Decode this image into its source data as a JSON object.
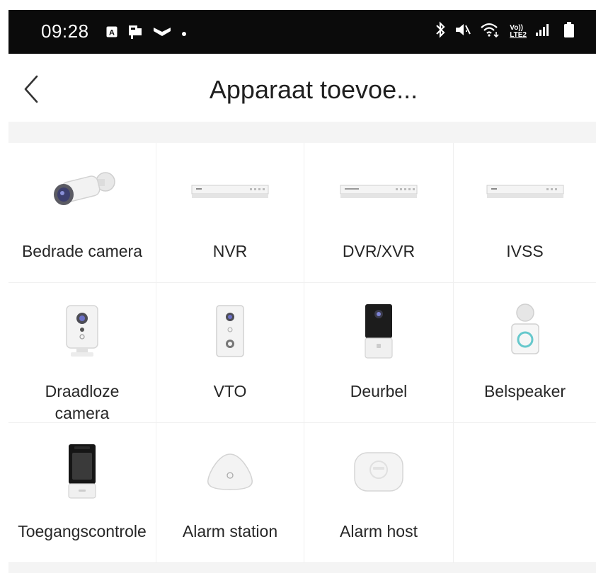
{
  "status_bar": {
    "time": "09:28",
    "left_icons": [
      "notification-a-icon",
      "notification-b-icon",
      "notification-c-icon",
      "dot-icon"
    ],
    "right_icons": [
      "bluetooth-icon",
      "mute-icon",
      "wifi-icon",
      "volte-icon",
      "signal-icon",
      "battery-icon"
    ],
    "volte_text_1": "Vo))",
    "volte_text_2": "LTE2"
  },
  "header": {
    "title": "Apparaat toevoe...",
    "back_icon": "chevron-left-icon"
  },
  "devices": [
    {
      "label": "Bedrade camera",
      "icon": "bullet-camera-icon"
    },
    {
      "label": "NVR",
      "icon": "nvr-recorder-icon"
    },
    {
      "label": "DVR/XVR",
      "icon": "dvr-recorder-icon"
    },
    {
      "label": "IVSS",
      "icon": "ivss-recorder-icon"
    },
    {
      "label": "Draadloze camera",
      "icon": "cube-camera-icon"
    },
    {
      "label": "VTO",
      "icon": "vto-intercom-icon"
    },
    {
      "label": "Deurbel",
      "icon": "doorbell-icon"
    },
    {
      "label": "Belspeaker",
      "icon": "chime-speaker-icon"
    },
    {
      "label": "Toegangscontrole",
      "icon": "access-control-icon"
    },
    {
      "label": "Alarm station",
      "icon": "alarm-station-icon"
    },
    {
      "label": "Alarm host",
      "icon": "alarm-host-icon"
    }
  ],
  "colors": {
    "status_bar_bg": "#0b0b0b",
    "title_text": "#1f1f1f",
    "label_text": "#262626",
    "divider": "#f0f0f0",
    "band_bg": "#f4f4f4"
  }
}
